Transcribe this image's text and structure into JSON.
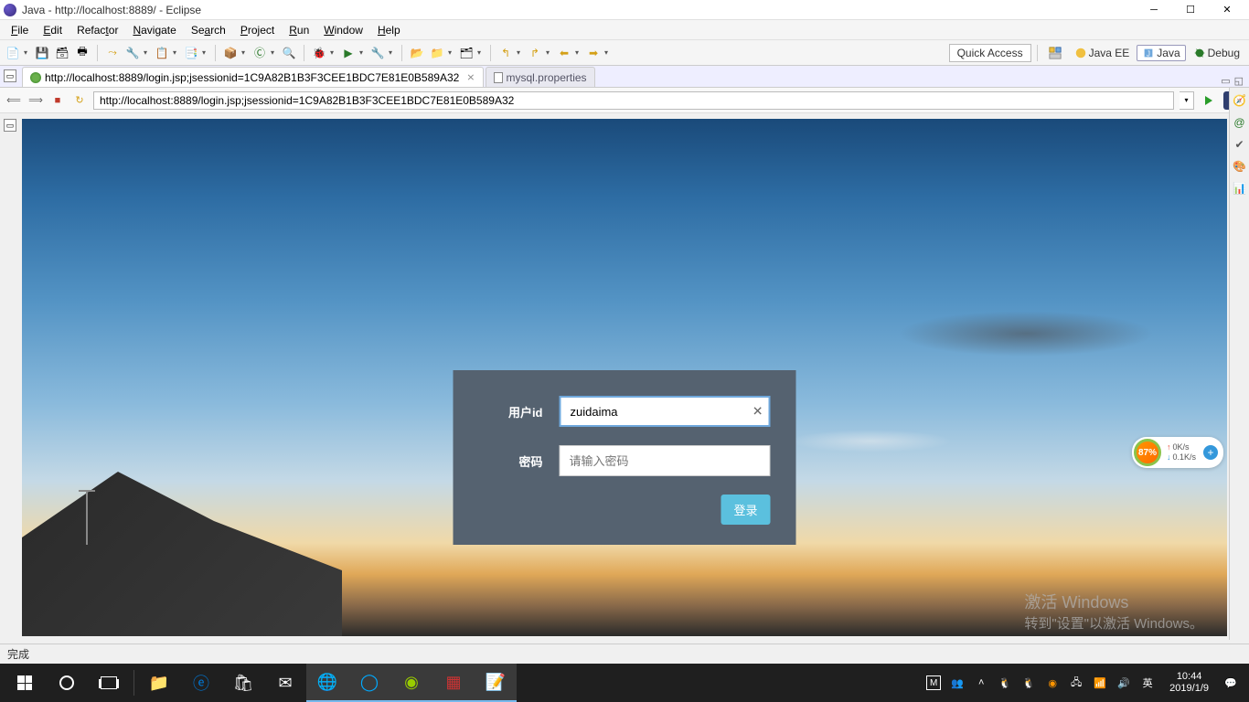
{
  "window": {
    "title": "Java - http://localhost:8889/ - Eclipse"
  },
  "menu": {
    "file": "File",
    "edit": "Edit",
    "refactor": "Refactor",
    "navigate": "Navigate",
    "search": "Search",
    "project": "Project",
    "run": "Run",
    "window": "Window",
    "help": "Help"
  },
  "quick_access": "Quick Access",
  "perspectives": {
    "java_ee": "Java EE",
    "java": "Java",
    "debug": "Debug"
  },
  "tabs": {
    "active": "http://localhost:8889/login.jsp;jsessionid=1C9A82B1B3F3CEE1BDC7E81E0B589A32",
    "inactive": "mysql.properties"
  },
  "browser": {
    "url": "http://localhost:8889/login.jsp;jsessionid=1C9A82B1B3F3CEE1BDC7E81E0B589A32"
  },
  "login": {
    "user_label": "用户id",
    "user_value": "zuidaima",
    "pwd_label": "密码",
    "pwd_placeholder": "请输入密码",
    "submit": "登录"
  },
  "watermark": {
    "title": "激活 Windows",
    "sub": "转到\"设置\"以激活 Windows。"
  },
  "status": "完成",
  "speed": {
    "percent": "87%",
    "up": "0K/s",
    "down": "0.1K/s"
  },
  "tray": {
    "ime": "英",
    "time": "10:44",
    "date": "2019/1/9",
    "m": "M"
  }
}
